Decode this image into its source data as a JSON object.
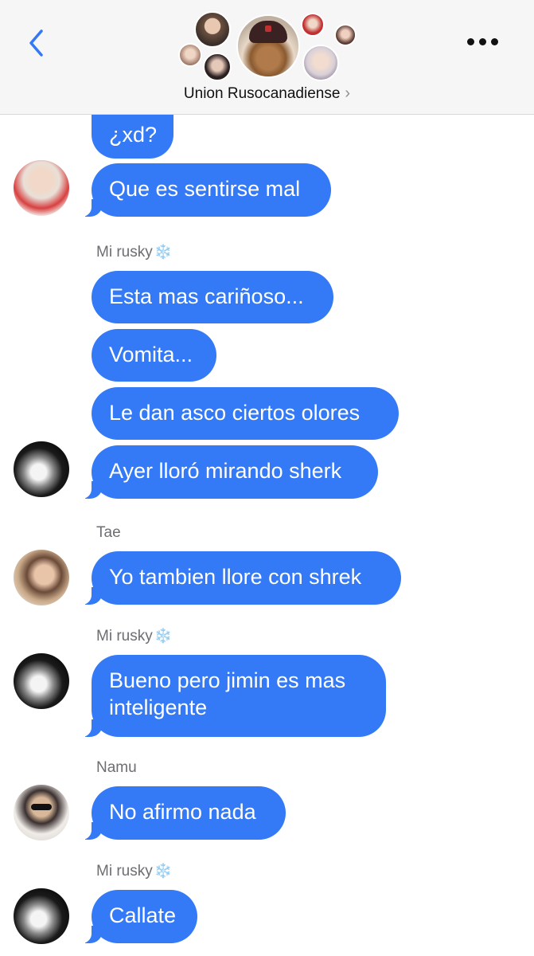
{
  "header": {
    "group_name": "Union Rusocanadiense",
    "chevron": "›"
  },
  "senders": {
    "mi_rusky": "Mi rusky",
    "tae": "Tae",
    "namu": "Namu",
    "snowflake": "❄️"
  },
  "messages": [
    {
      "text": "¿xd?"
    },
    {
      "text": "Que es sentirse mal"
    },
    {
      "text": "Esta mas cariñoso..."
    },
    {
      "text": "Vomita..."
    },
    {
      "text": "Le dan asco ciertos olores"
    },
    {
      "text": "Ayer lloró mirando sherk"
    },
    {
      "text": "Yo tambien llore con shrek"
    },
    {
      "line1": "Bueno pero jimin es mas",
      "line2": "inteligente"
    },
    {
      "text": "No afirmo nada"
    },
    {
      "text": "Callate"
    }
  ],
  "colors": {
    "bubble": "#3479f6",
    "accent": "#3478f6",
    "header_bg": "#f6f6f6",
    "sender_label": "#6d6d72"
  },
  "icons": {
    "back": "chevron-left-icon",
    "more": "more-dots-icon",
    "disclosure": "chevron-right-icon"
  }
}
